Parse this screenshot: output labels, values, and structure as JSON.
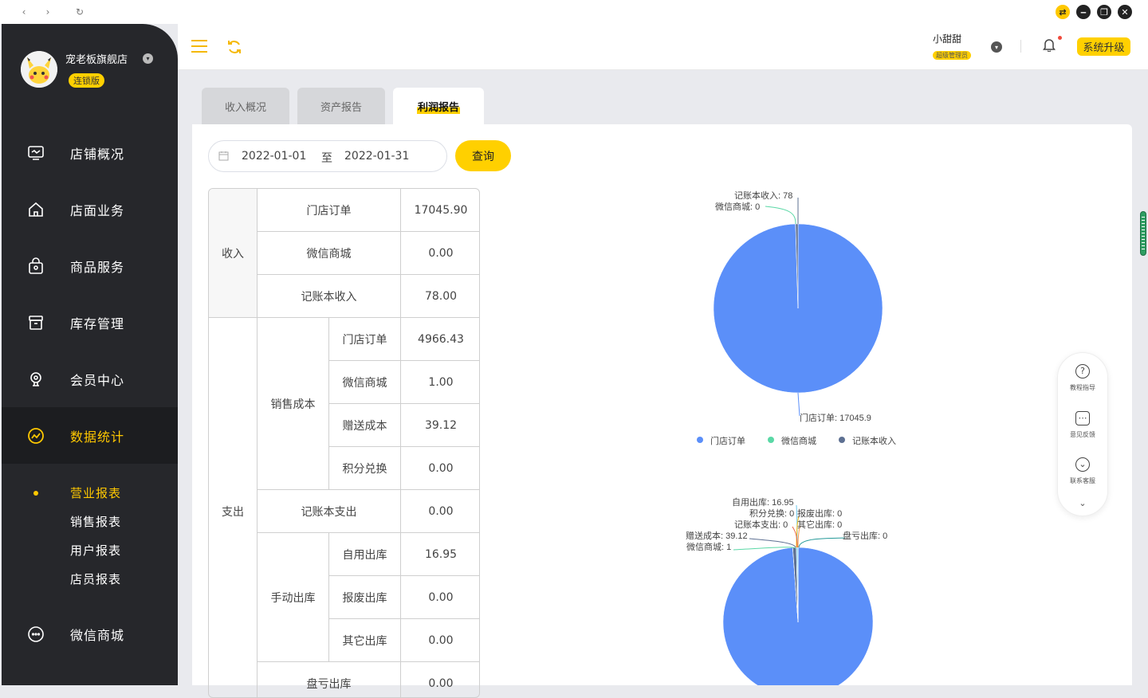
{
  "shop": {
    "name": "宠老板旗舰店",
    "badge": "连锁版"
  },
  "nav": [
    {
      "label": "店铺概况",
      "icon": "monitor-icon"
    },
    {
      "label": "店面业务",
      "icon": "home-icon"
    },
    {
      "label": "商品服务",
      "icon": "bag-icon"
    },
    {
      "label": "库存管理",
      "icon": "box-icon"
    },
    {
      "label": "会员中心",
      "icon": "member-icon"
    },
    {
      "label": "数据统计",
      "icon": "chart-icon"
    },
    {
      "label": "微信商城",
      "icon": "chat-icon"
    }
  ],
  "subnav": [
    "营业报表",
    "销售报表",
    "用户报表",
    "店员报表"
  ],
  "user": {
    "name": "小甜甜",
    "role": "超级管理员"
  },
  "topbar": {
    "upgrade": "系统升级"
  },
  "tabs": [
    "收入概况",
    "资产报告",
    "利润报告"
  ],
  "filter": {
    "start": "2022-01-01",
    "sep": "至",
    "end": "2022-01-31",
    "query": "查询"
  },
  "table": {
    "income_label": "收入",
    "income": [
      {
        "label": "门店订单",
        "value": "17045.90"
      },
      {
        "label": "微信商城",
        "value": "0.00"
      },
      {
        "label": "记账本收入",
        "value": "78.00"
      }
    ],
    "expense_label": "支出",
    "sales_cost_label": "销售成本",
    "sales_cost": [
      {
        "label": "门店订单",
        "value": "4966.43"
      },
      {
        "label": "微信商城",
        "value": "1.00"
      },
      {
        "label": "赠送成本",
        "value": "39.12"
      },
      {
        "label": "积分兑换",
        "value": "0.00"
      }
    ],
    "ledger_expense": {
      "label": "记账本支出",
      "value": "0.00"
    },
    "manual_out_label": "手动出库",
    "manual_out": [
      {
        "label": "自用出库",
        "value": "16.95"
      },
      {
        "label": "报废出库",
        "value": "0.00"
      },
      {
        "label": "其它出库",
        "value": "0.00"
      }
    ],
    "loss_out": {
      "label": "盘亏出库",
      "value": "0.00"
    }
  },
  "chart_data": [
    {
      "type": "pie",
      "categories": [
        "门店订单",
        "微信商城",
        "记账本收入"
      ],
      "values": [
        17045.9,
        0,
        78
      ],
      "labels": [
        "门店订单: 17045.9",
        "微信商城: 0",
        "记账本收入: 78"
      ],
      "legend": [
        "门店订单",
        "微信商城",
        "记账本收入"
      ],
      "colors": [
        "#5b8ff9",
        "#5ad8a6",
        "#5d7092"
      ],
      "legend_position": "bottom"
    },
    {
      "type": "pie",
      "categories": [
        "门店订单",
        "微信商城",
        "赠送成本",
        "积分兑换",
        "记账本支出",
        "自用出库",
        "报废出库",
        "其它出库",
        "盘亏出库"
      ],
      "values": [
        4966.43,
        1,
        39.12,
        0,
        0,
        16.95,
        0,
        0,
        0
      ],
      "labels": [
        "微信商城: 1",
        "赠送成本: 39.12",
        "记账本支出: 0",
        "积分兑换: 0",
        "自用出库: 16.95",
        "报废出库: 0",
        "其它出库: 0",
        "盘亏出库: 0"
      ],
      "colors": [
        "#5b8ff9",
        "#5ad8a6",
        "#5d7092",
        "#f6bd16",
        "#e8684a",
        "#6dc8ec",
        "#9270ca",
        "#ff9d4d",
        "#269a99"
      ]
    }
  ],
  "helper": [
    "教程指导",
    "意见反馈",
    "联系客服"
  ]
}
